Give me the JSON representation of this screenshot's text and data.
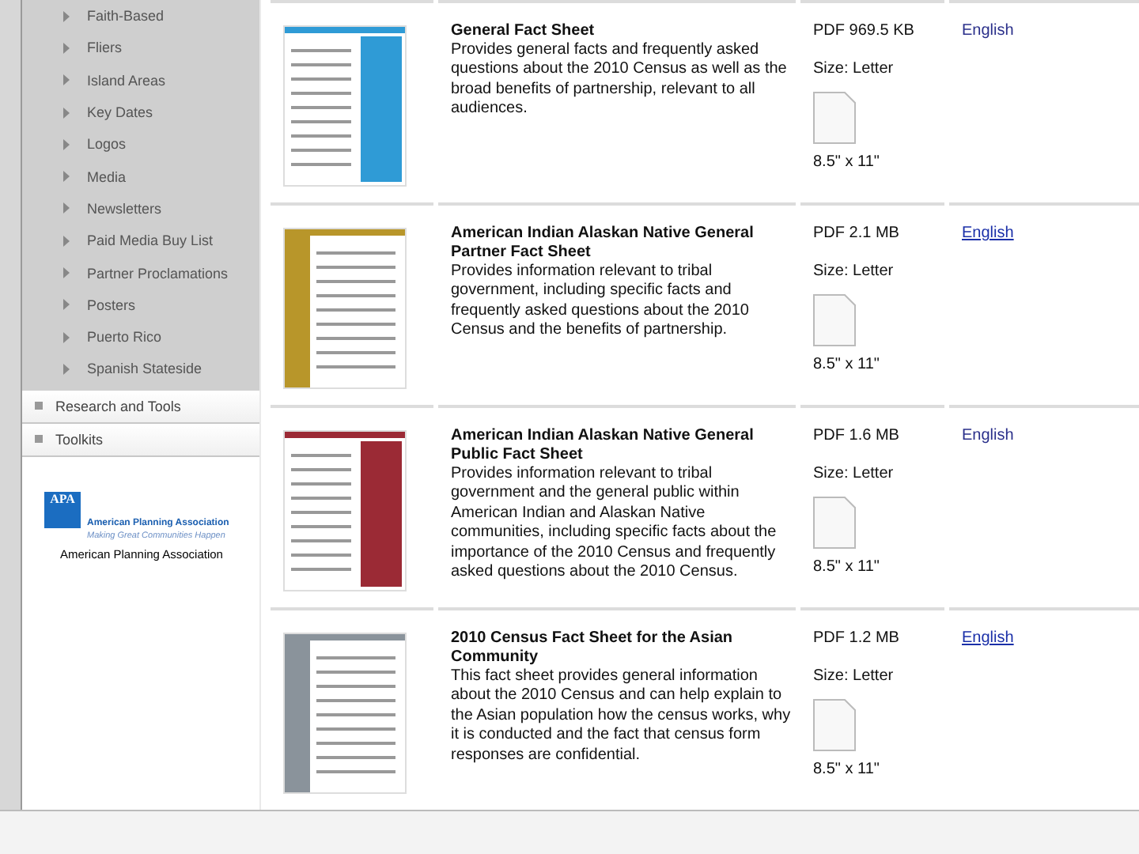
{
  "sidebar": {
    "items": [
      {
        "label": "Faith-Based"
      },
      {
        "label": "Fliers"
      },
      {
        "label": "Island Areas"
      },
      {
        "label": "Key Dates"
      },
      {
        "label": "Logos"
      },
      {
        "label": "Media"
      },
      {
        "label": "Newsletters"
      },
      {
        "label": "Paid Media Buy List"
      },
      {
        "label": "Partner Proclamations"
      },
      {
        "label": "Posters"
      },
      {
        "label": "Puerto Rico"
      },
      {
        "label": "Spanish Stateside"
      }
    ],
    "sections": [
      {
        "label": "Research and Tools"
      },
      {
        "label": "Toolkits"
      }
    ],
    "logo": {
      "mark": "APA",
      "name": "American Planning Association",
      "tagline": "Making Great Communities Happen",
      "caption": "American Planning Association"
    }
  },
  "documents": [
    {
      "title": "General Fact Sheet",
      "description": "Provides general facts and frequently asked questions about the 2010 Census as well as the broad benefits of partnership, relevant to all audiences.",
      "file": "PDF 969.5 KB",
      "size": "Size: Letter",
      "dimensions": "8.5\" x 11\"",
      "language": "English",
      "underlined": false,
      "color": "#2f9bd6"
    },
    {
      "title": "American Indian Alaskan Native General Partner Fact Sheet",
      "description": "Provides information relevant to tribal government, including specific facts and frequently asked questions about the 2010 Census and the benefits of partnership.",
      "file": "PDF 2.1 MB",
      "size": "Size: Letter",
      "dimensions": "8.5\" x 11\"",
      "language": "English",
      "underlined": true,
      "color": "#b8962a"
    },
    {
      "title": "American Indian Alaskan Native General Public Fact Sheet",
      "description": "Provides information relevant to tribal government and the general public within American Indian and Alaskan Native communities, including specific facts about the importance of the 2010 Census and frequently asked questions about the 2010 Census.",
      "file": "PDF 1.6 MB",
      "size": "Size: Letter",
      "dimensions": "8.5\" x 11\"",
      "language": "English",
      "underlined": false,
      "color": "#9b2a35"
    },
    {
      "title": "2010 Census Fact Sheet for the Asian Community",
      "description": "This fact sheet provides general information about the 2010 Census and can help explain to the Asian population how the census works, why it is conducted and the fact that census form responses are confidential.",
      "file": "PDF 1.2 MB",
      "size": "Size: Letter",
      "dimensions": "8.5\" x 11\"",
      "language": "English",
      "underlined": true,
      "color": "#8a939b"
    }
  ]
}
